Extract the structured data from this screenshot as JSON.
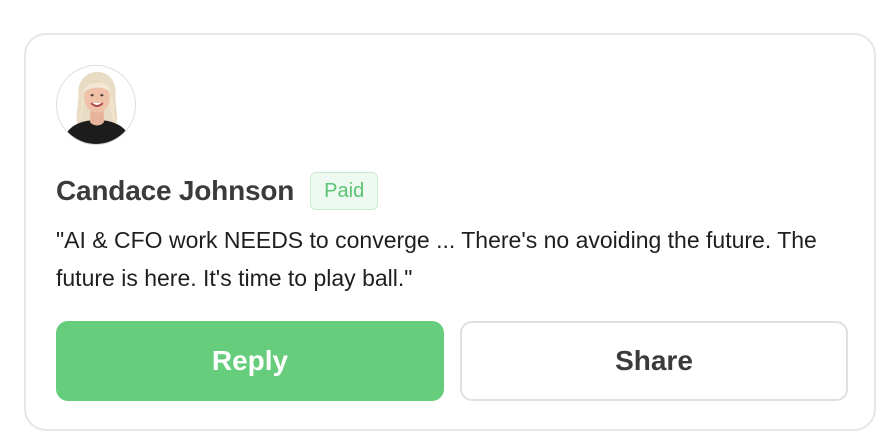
{
  "card": {
    "author_name": "Candace Johnson",
    "badge_label": "Paid",
    "quote": "\"AI & CFO work NEEDS to converge ... There's no avoiding the future. The future is here. It's time to play ball.\""
  },
  "actions": {
    "reply_label": "Reply",
    "share_label": "Share"
  },
  "colors": {
    "accent_green": "#66cd7d",
    "badge_text": "#5cc373",
    "badge_bg": "#eef9f1",
    "name_text": "#3b3b3b"
  }
}
